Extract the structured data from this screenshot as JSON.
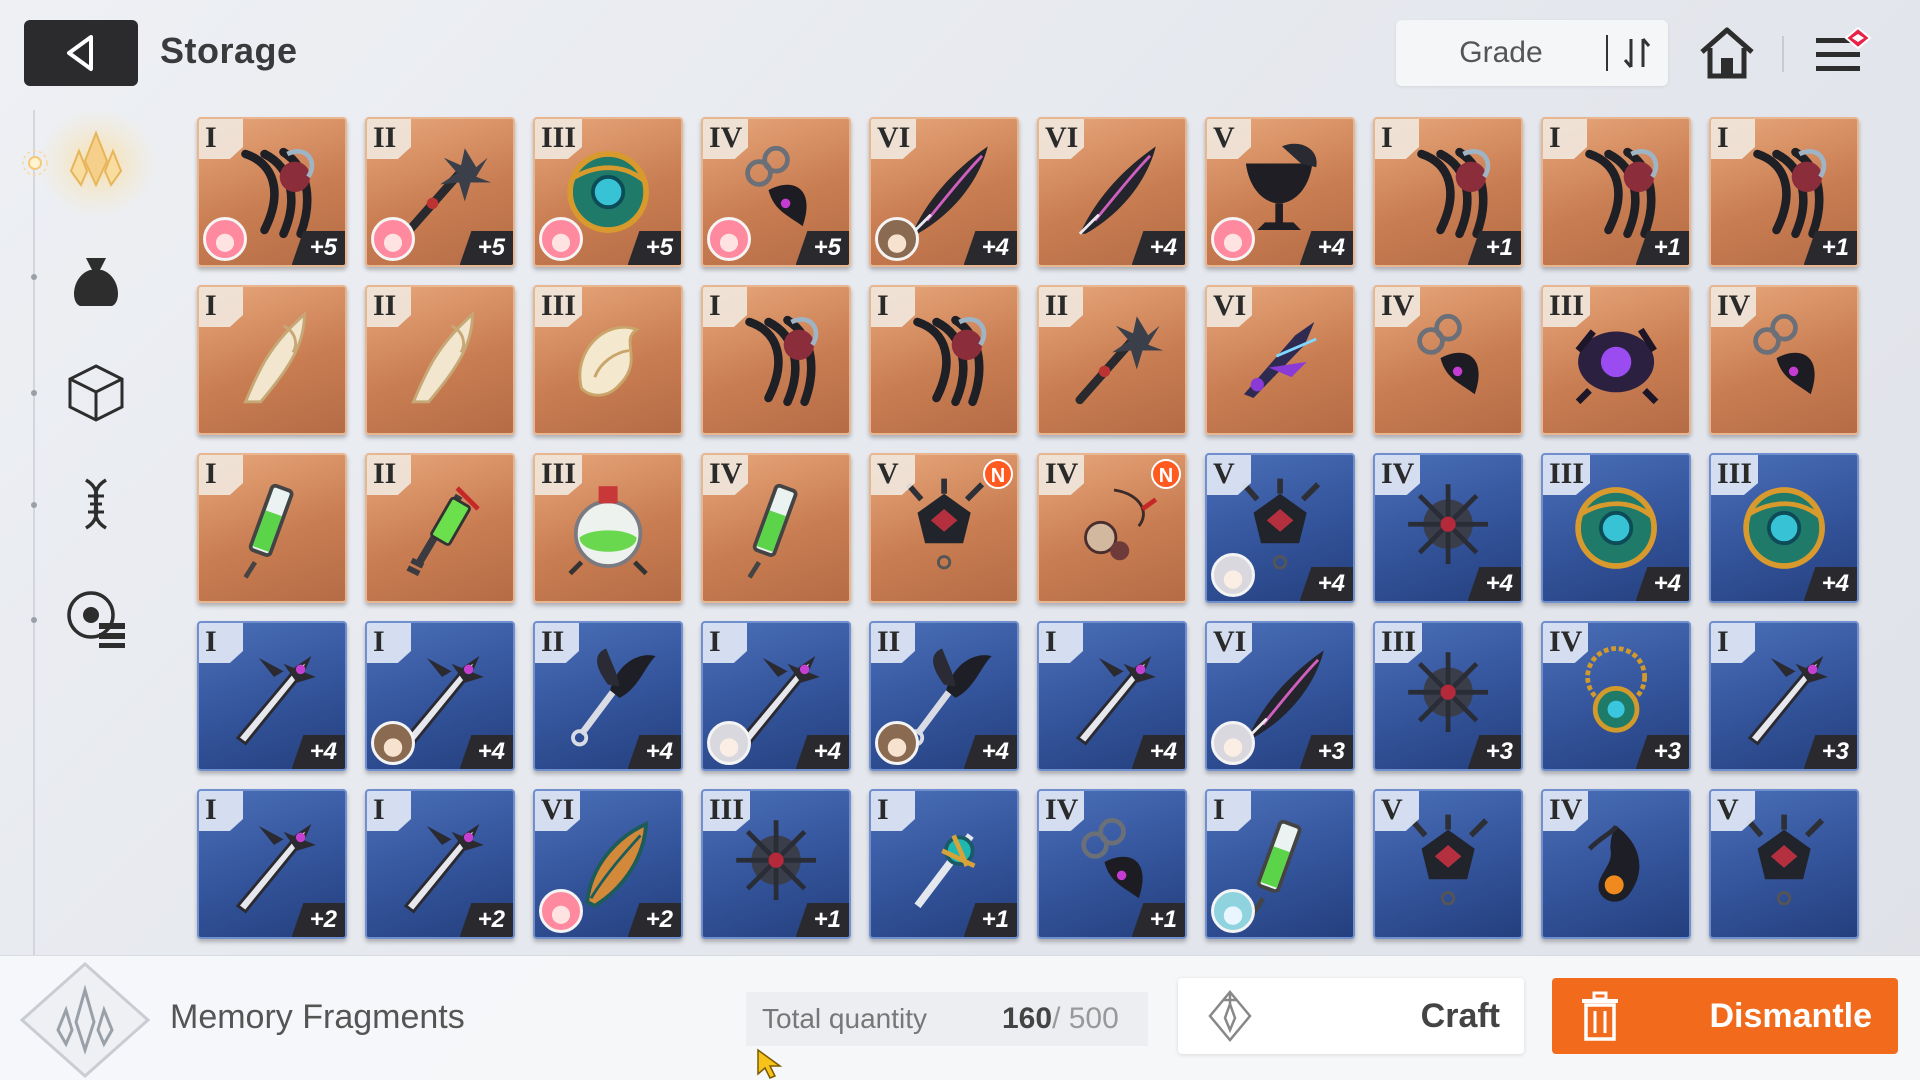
{
  "header": {
    "title": "Storage",
    "sort_label": "Grade"
  },
  "sidebar": {
    "items": [
      {
        "name": "memory-fragments",
        "icon": "crystal-icon",
        "active": true
      },
      {
        "name": "materials",
        "icon": "pouch-icon",
        "active": false
      },
      {
        "name": "items",
        "icon": "cube-icon",
        "active": false
      },
      {
        "name": "dna",
        "icon": "dna-icon",
        "active": false
      },
      {
        "name": "records",
        "icon": "disc-list-icon",
        "active": false
      }
    ]
  },
  "grid": {
    "items": [
      {
        "grade": "I",
        "level": "+5",
        "color": "orange",
        "avatar": "pink",
        "art": "claw",
        "new": false
      },
      {
        "grade": "II",
        "level": "+5",
        "color": "orange",
        "avatar": "pink",
        "art": "staff",
        "new": false
      },
      {
        "grade": "III",
        "level": "+5",
        "color": "orange",
        "avatar": "pink",
        "art": "orb",
        "new": false
      },
      {
        "grade": "IV",
        "level": "+5",
        "color": "orange",
        "avatar": "pink",
        "art": "chain",
        "new": false
      },
      {
        "grade": "VI",
        "level": "+4",
        "color": "orange",
        "avatar": "brown",
        "art": "feather",
        "new": false
      },
      {
        "grade": "VI",
        "level": "+4",
        "color": "orange",
        "avatar": "",
        "art": "feather",
        "new": false
      },
      {
        "grade": "V",
        "level": "+4",
        "color": "orange",
        "avatar": "pink",
        "art": "goblet",
        "new": false
      },
      {
        "grade": "I",
        "level": "+1",
        "color": "orange",
        "avatar": "",
        "art": "claw",
        "new": false
      },
      {
        "grade": "I",
        "level": "+1",
        "color": "orange",
        "avatar": "",
        "art": "claw",
        "new": false
      },
      {
        "grade": "I",
        "level": "+1",
        "color": "orange",
        "avatar": "",
        "art": "claw",
        "new": false
      },
      {
        "grade": "I",
        "level": "",
        "color": "orange",
        "avatar": "",
        "art": "bone",
        "new": false
      },
      {
        "grade": "II",
        "level": "",
        "color": "orange",
        "avatar": "",
        "art": "bone",
        "new": false
      },
      {
        "grade": "III",
        "level": "",
        "color": "orange",
        "avatar": "",
        "art": "shell",
        "new": false
      },
      {
        "grade": "I",
        "level": "",
        "color": "orange",
        "avatar": "",
        "art": "claw",
        "new": false
      },
      {
        "grade": "I",
        "level": "",
        "color": "orange",
        "avatar": "",
        "art": "claw",
        "new": false
      },
      {
        "grade": "II",
        "level": "",
        "color": "orange",
        "avatar": "",
        "art": "staff",
        "new": false
      },
      {
        "grade": "VI",
        "level": "",
        "color": "orange",
        "avatar": "",
        "art": "dagger",
        "new": false
      },
      {
        "grade": "IV",
        "level": "",
        "color": "orange",
        "avatar": "",
        "art": "chain",
        "new": false
      },
      {
        "grade": "III",
        "level": "",
        "color": "orange",
        "avatar": "",
        "art": "core",
        "new": false
      },
      {
        "grade": "IV",
        "level": "",
        "color": "orange",
        "avatar": "",
        "art": "chain",
        "new": false
      },
      {
        "grade": "I",
        "level": "",
        "color": "orange",
        "avatar": "",
        "art": "vial",
        "new": false
      },
      {
        "grade": "II",
        "level": "",
        "color": "orange",
        "avatar": "",
        "art": "key",
        "new": false
      },
      {
        "grade": "III",
        "level": "",
        "color": "orange",
        "avatar": "",
        "art": "flask",
        "new": false
      },
      {
        "grade": "IV",
        "level": "",
        "color": "orange",
        "avatar": "",
        "art": "vial",
        "new": false
      },
      {
        "grade": "V",
        "level": "",
        "color": "orange",
        "avatar": "",
        "art": "bell",
        "new": true
      },
      {
        "grade": "IV",
        "level": "",
        "color": "orange",
        "avatar": "",
        "art": "charm",
        "new": true
      },
      {
        "grade": "V",
        "level": "+4",
        "color": "blue",
        "avatar": "white",
        "art": "bell",
        "new": false
      },
      {
        "grade": "IV",
        "level": "+4",
        "color": "blue",
        "avatar": "",
        "art": "mace",
        "new": false
      },
      {
        "grade": "III",
        "level": "+4",
        "color": "blue",
        "avatar": "",
        "art": "orb",
        "new": false
      },
      {
        "grade": "III",
        "level": "+4",
        "color": "blue",
        "avatar": "",
        "art": "orb",
        "new": false
      },
      {
        "grade": "I",
        "level": "+4",
        "color": "blue",
        "avatar": "",
        "art": "blade",
        "new": false
      },
      {
        "grade": "I",
        "level": "+4",
        "color": "blue",
        "avatar": "brown",
        "art": "blade",
        "new": false
      },
      {
        "grade": "II",
        "level": "+4",
        "color": "blue",
        "avatar": "",
        "art": "wingkey",
        "new": false
      },
      {
        "grade": "I",
        "level": "+4",
        "color": "blue",
        "avatar": "white",
        "art": "blade",
        "new": false
      },
      {
        "grade": "II",
        "level": "+4",
        "color": "blue",
        "avatar": "brown",
        "art": "wingkey",
        "new": false
      },
      {
        "grade": "I",
        "level": "+4",
        "color": "blue",
        "avatar": "",
        "art": "blade",
        "new": false
      },
      {
        "grade": "VI",
        "level": "+3",
        "color": "blue",
        "avatar": "white",
        "art": "feather",
        "new": false
      },
      {
        "grade": "III",
        "level": "+3",
        "color": "blue",
        "avatar": "",
        "art": "mace",
        "new": false
      },
      {
        "grade": "IV",
        "level": "+3",
        "color": "blue",
        "avatar": "",
        "art": "amulet",
        "new": false
      },
      {
        "grade": "I",
        "level": "+3",
        "color": "blue",
        "avatar": "",
        "art": "blade",
        "new": false
      },
      {
        "grade": "I",
        "level": "+2",
        "color": "blue",
        "avatar": "",
        "art": "blade",
        "new": false
      },
      {
        "grade": "I",
        "level": "+2",
        "color": "blue",
        "avatar": "",
        "art": "blade",
        "new": false
      },
      {
        "grade": "VI",
        "level": "+2",
        "color": "blue",
        "avatar": "pink",
        "art": "plume",
        "new": false
      },
      {
        "grade": "III",
        "level": "+1",
        "color": "blue",
        "avatar": "",
        "art": "mace",
        "new": false
      },
      {
        "grade": "I",
        "level": "+1",
        "color": "blue",
        "avatar": "",
        "art": "sword",
        "new": false
      },
      {
        "grade": "IV",
        "level": "+1",
        "color": "blue",
        "avatar": "",
        "art": "chain",
        "new": false
      },
      {
        "grade": "I",
        "level": "",
        "color": "blue",
        "avatar": "teal",
        "art": "vial",
        "new": false
      },
      {
        "grade": "V",
        "level": "",
        "color": "blue",
        "avatar": "",
        "art": "bell",
        "new": false
      },
      {
        "grade": "IV",
        "level": "",
        "color": "blue",
        "avatar": "",
        "art": "flame",
        "new": false
      },
      {
        "grade": "V",
        "level": "",
        "color": "blue",
        "avatar": "",
        "art": "bell",
        "new": false
      }
    ],
    "new_badge_label": "N"
  },
  "footer": {
    "category_label": "Memory Fragments",
    "total_label": "Total quantity",
    "total_value": "160",
    "total_max": " / 500",
    "craft_label": "Craft",
    "dismantle_label": "Dismantle"
  },
  "colors": {
    "accent": "#f26a1b",
    "orange_tile": "#c97d52",
    "blue_tile": "#33539a",
    "new_badge": "#ff5a1f"
  }
}
